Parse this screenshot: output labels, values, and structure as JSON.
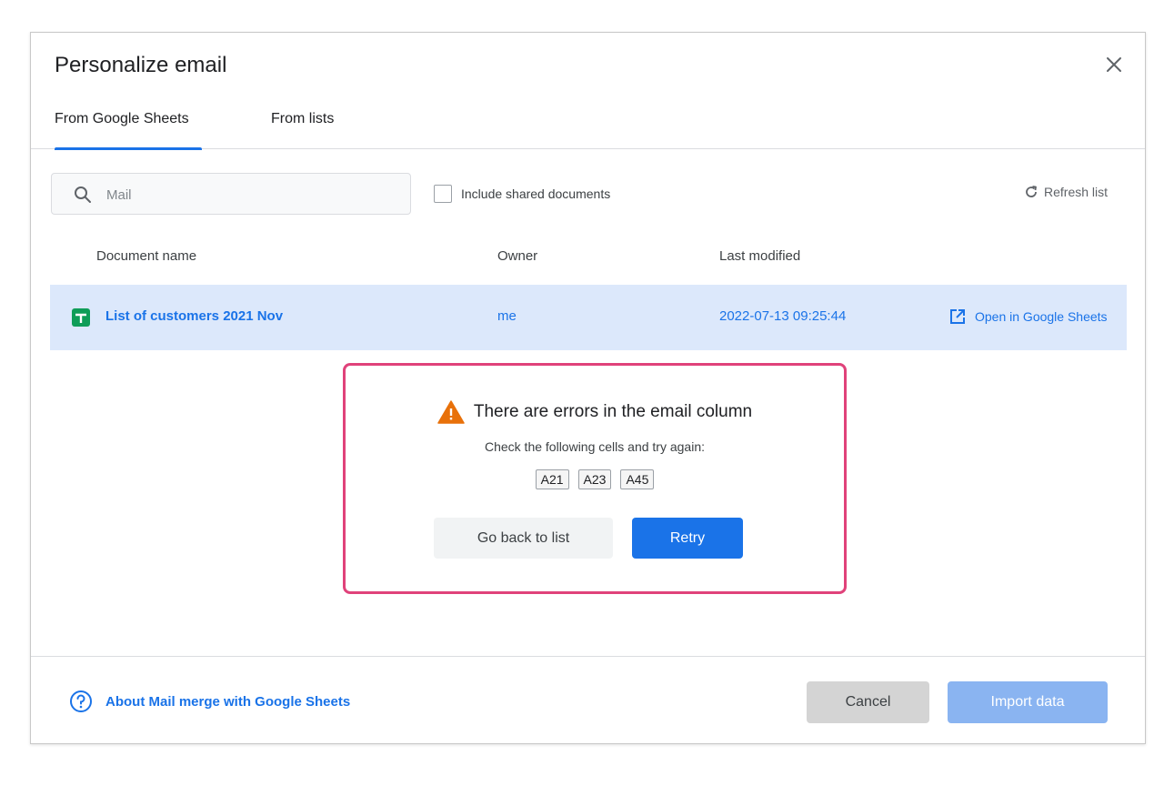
{
  "dialog": {
    "title": "Personalize email"
  },
  "tabs": [
    {
      "label": "From Google Sheets",
      "active": true
    },
    {
      "label": "From lists",
      "active": false
    }
  ],
  "toolbar": {
    "search_placeholder": "Mail",
    "include_shared_label": "Include shared documents",
    "include_shared_checked": false,
    "refresh_label": "Refresh list"
  },
  "table": {
    "columns": [
      "Document name",
      "Owner",
      "Last modified"
    ],
    "rows": [
      {
        "name": "List of customers 2021 Nov",
        "owner": "me",
        "modified": "2022-07-13 09:25:44",
        "open_label": "Open in Google Sheets",
        "icon": "google-sheets-icon",
        "selected": true
      }
    ]
  },
  "error": {
    "title": "There are errors in the email column",
    "subtitle": "Check the following cells and try again:",
    "cells": [
      "A21",
      "A23",
      "A45"
    ],
    "back_label": "Go back to list",
    "retry_label": "Retry",
    "icon": "warning-icon"
  },
  "footer": {
    "help_label": "About Mail merge with Google Sheets",
    "cancel_label": "Cancel",
    "import_label": "Import data"
  },
  "colors": {
    "accent": "#1a73e8",
    "selected_row": "#dce8fb",
    "error_border": "#e0427a",
    "warning": "#e8710a",
    "sheets_green": "#0f9d58"
  }
}
